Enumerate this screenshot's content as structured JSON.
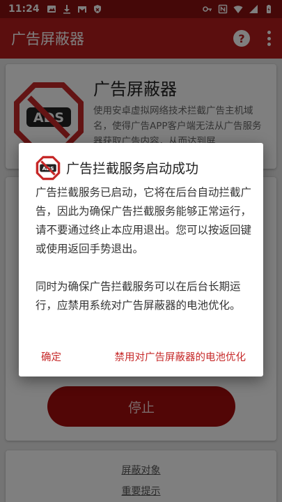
{
  "status_bar": {
    "time": "11:24",
    "left_icons": [
      "image-icon",
      "download-icon",
      "gmail-icon",
      "shield-icon"
    ],
    "right_icons": [
      "vpn-key-icon",
      "nfc-icon",
      "wifi-icon",
      "signal-icon",
      "battery-charging-icon"
    ]
  },
  "app_bar": {
    "title": "广告屏蔽器",
    "help_icon": "?"
  },
  "intro": {
    "title": "广告屏蔽器",
    "description": "使用安卓虚拟网络技术拦截广告主机域名，使得广告APP客户端无法从广告服务器获取广告内容，从而达到屏"
  },
  "stop_button": "停止",
  "links": {
    "blocked_objects": "屏蔽对象",
    "important_tips": "重要提示"
  },
  "dialog": {
    "title": "广告拦截服务启动成功",
    "paragraph_1": "广告拦截服务已启动，它将在后台自动拦截广告，因此为确保广告拦截服务能够正常运行，请不要通过终止本应用退出。您可以按返回键或使用返回手势退出。",
    "paragraph_2": "同时为确保广告拦截服务可以在后台长期运行，应禁用系统对广告屏蔽器的电池优化。",
    "confirm_button": "确定",
    "disable_optimization_button": "禁用对广告屏蔽器的电池优化"
  },
  "colors": {
    "primary": "#b71c1c",
    "primary_dark": "#8a1010",
    "accent_text": "#c62828"
  }
}
